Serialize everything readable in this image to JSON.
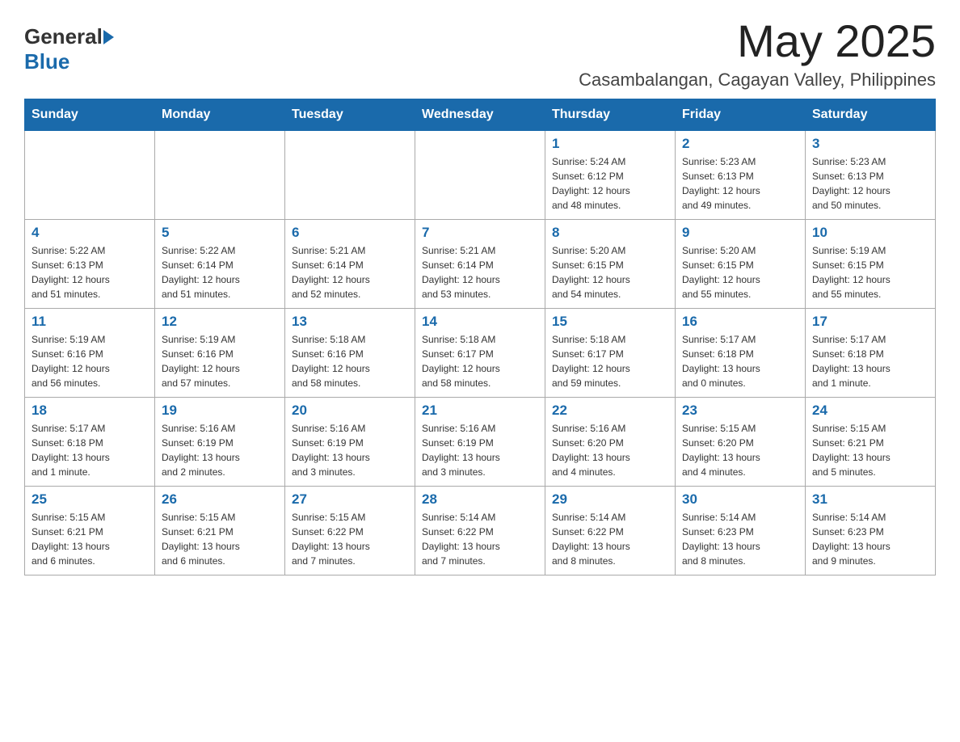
{
  "header": {
    "month_title": "May 2025",
    "location": "Casambalangan, Cagayan Valley, Philippines",
    "logo_general": "General",
    "logo_blue": "Blue"
  },
  "days_of_week": [
    "Sunday",
    "Monday",
    "Tuesday",
    "Wednesday",
    "Thursday",
    "Friday",
    "Saturday"
  ],
  "weeks": [
    [
      {
        "day": "",
        "info": ""
      },
      {
        "day": "",
        "info": ""
      },
      {
        "day": "",
        "info": ""
      },
      {
        "day": "",
        "info": ""
      },
      {
        "day": "1",
        "info": "Sunrise: 5:24 AM\nSunset: 6:12 PM\nDaylight: 12 hours\nand 48 minutes."
      },
      {
        "day": "2",
        "info": "Sunrise: 5:23 AM\nSunset: 6:13 PM\nDaylight: 12 hours\nand 49 minutes."
      },
      {
        "day": "3",
        "info": "Sunrise: 5:23 AM\nSunset: 6:13 PM\nDaylight: 12 hours\nand 50 minutes."
      }
    ],
    [
      {
        "day": "4",
        "info": "Sunrise: 5:22 AM\nSunset: 6:13 PM\nDaylight: 12 hours\nand 51 minutes."
      },
      {
        "day": "5",
        "info": "Sunrise: 5:22 AM\nSunset: 6:14 PM\nDaylight: 12 hours\nand 51 minutes."
      },
      {
        "day": "6",
        "info": "Sunrise: 5:21 AM\nSunset: 6:14 PM\nDaylight: 12 hours\nand 52 minutes."
      },
      {
        "day": "7",
        "info": "Sunrise: 5:21 AM\nSunset: 6:14 PM\nDaylight: 12 hours\nand 53 minutes."
      },
      {
        "day": "8",
        "info": "Sunrise: 5:20 AM\nSunset: 6:15 PM\nDaylight: 12 hours\nand 54 minutes."
      },
      {
        "day": "9",
        "info": "Sunrise: 5:20 AM\nSunset: 6:15 PM\nDaylight: 12 hours\nand 55 minutes."
      },
      {
        "day": "10",
        "info": "Sunrise: 5:19 AM\nSunset: 6:15 PM\nDaylight: 12 hours\nand 55 minutes."
      }
    ],
    [
      {
        "day": "11",
        "info": "Sunrise: 5:19 AM\nSunset: 6:16 PM\nDaylight: 12 hours\nand 56 minutes."
      },
      {
        "day": "12",
        "info": "Sunrise: 5:19 AM\nSunset: 6:16 PM\nDaylight: 12 hours\nand 57 minutes."
      },
      {
        "day": "13",
        "info": "Sunrise: 5:18 AM\nSunset: 6:16 PM\nDaylight: 12 hours\nand 58 minutes."
      },
      {
        "day": "14",
        "info": "Sunrise: 5:18 AM\nSunset: 6:17 PM\nDaylight: 12 hours\nand 58 minutes."
      },
      {
        "day": "15",
        "info": "Sunrise: 5:18 AM\nSunset: 6:17 PM\nDaylight: 12 hours\nand 59 minutes."
      },
      {
        "day": "16",
        "info": "Sunrise: 5:17 AM\nSunset: 6:18 PM\nDaylight: 13 hours\nand 0 minutes."
      },
      {
        "day": "17",
        "info": "Sunrise: 5:17 AM\nSunset: 6:18 PM\nDaylight: 13 hours\nand 1 minute."
      }
    ],
    [
      {
        "day": "18",
        "info": "Sunrise: 5:17 AM\nSunset: 6:18 PM\nDaylight: 13 hours\nand 1 minute."
      },
      {
        "day": "19",
        "info": "Sunrise: 5:16 AM\nSunset: 6:19 PM\nDaylight: 13 hours\nand 2 minutes."
      },
      {
        "day": "20",
        "info": "Sunrise: 5:16 AM\nSunset: 6:19 PM\nDaylight: 13 hours\nand 3 minutes."
      },
      {
        "day": "21",
        "info": "Sunrise: 5:16 AM\nSunset: 6:19 PM\nDaylight: 13 hours\nand 3 minutes."
      },
      {
        "day": "22",
        "info": "Sunrise: 5:16 AM\nSunset: 6:20 PM\nDaylight: 13 hours\nand 4 minutes."
      },
      {
        "day": "23",
        "info": "Sunrise: 5:15 AM\nSunset: 6:20 PM\nDaylight: 13 hours\nand 4 minutes."
      },
      {
        "day": "24",
        "info": "Sunrise: 5:15 AM\nSunset: 6:21 PM\nDaylight: 13 hours\nand 5 minutes."
      }
    ],
    [
      {
        "day": "25",
        "info": "Sunrise: 5:15 AM\nSunset: 6:21 PM\nDaylight: 13 hours\nand 6 minutes."
      },
      {
        "day": "26",
        "info": "Sunrise: 5:15 AM\nSunset: 6:21 PM\nDaylight: 13 hours\nand 6 minutes."
      },
      {
        "day": "27",
        "info": "Sunrise: 5:15 AM\nSunset: 6:22 PM\nDaylight: 13 hours\nand 7 minutes."
      },
      {
        "day": "28",
        "info": "Sunrise: 5:14 AM\nSunset: 6:22 PM\nDaylight: 13 hours\nand 7 minutes."
      },
      {
        "day": "29",
        "info": "Sunrise: 5:14 AM\nSunset: 6:22 PM\nDaylight: 13 hours\nand 8 minutes."
      },
      {
        "day": "30",
        "info": "Sunrise: 5:14 AM\nSunset: 6:23 PM\nDaylight: 13 hours\nand 8 minutes."
      },
      {
        "day": "31",
        "info": "Sunrise: 5:14 AM\nSunset: 6:23 PM\nDaylight: 13 hours\nand 9 minutes."
      }
    ]
  ]
}
